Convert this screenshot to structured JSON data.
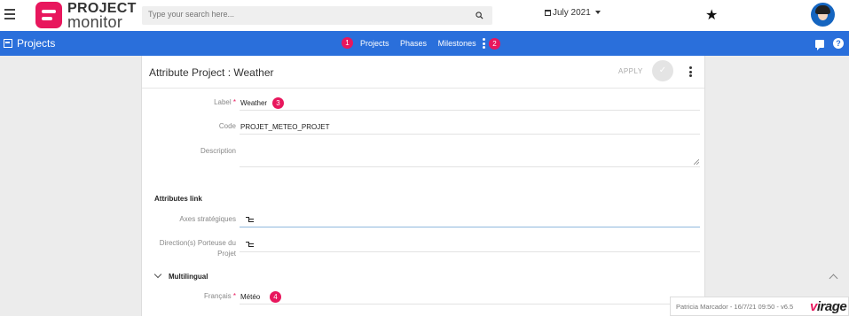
{
  "topbar": {
    "logo_line1": "PROJECT",
    "logo_line2": "monitor",
    "search_placeholder": "Type your search here...",
    "date_label": "July 2021"
  },
  "navbar": {
    "title": "Projects",
    "tabs": [
      "Projects",
      "Phases",
      "Milestones"
    ],
    "badges": [
      "1",
      "2"
    ]
  },
  "card": {
    "title": "Attribute Project : Weather",
    "apply_label": "APPLY"
  },
  "form": {
    "label_field": {
      "label": "Label",
      "required": "*",
      "value": "Weather",
      "badge": "3"
    },
    "code_field": {
      "label": "Code",
      "value": "PROJET_METEO_PROJET"
    },
    "description_field": {
      "label": "Description",
      "value": ""
    },
    "attributes_section": "Attributes link",
    "axes_field": {
      "label": "Axes stratégiques"
    },
    "direction_field": {
      "label_line1": "Direction(s) Porteuse du",
      "label_line2": "Projet"
    },
    "multilingual_section": "Multilingual",
    "francais_field": {
      "label": "Français",
      "required": "*",
      "value": "Météo",
      "badge": "4"
    }
  },
  "footer": {
    "text": "Patricia Marcador - 16/7/21 09:50 - v6.5",
    "brand_accent": "v",
    "brand_rest": "irage"
  },
  "colors": {
    "nav_blue": "#2a6fdb",
    "accent_pink": "#e8175d"
  }
}
